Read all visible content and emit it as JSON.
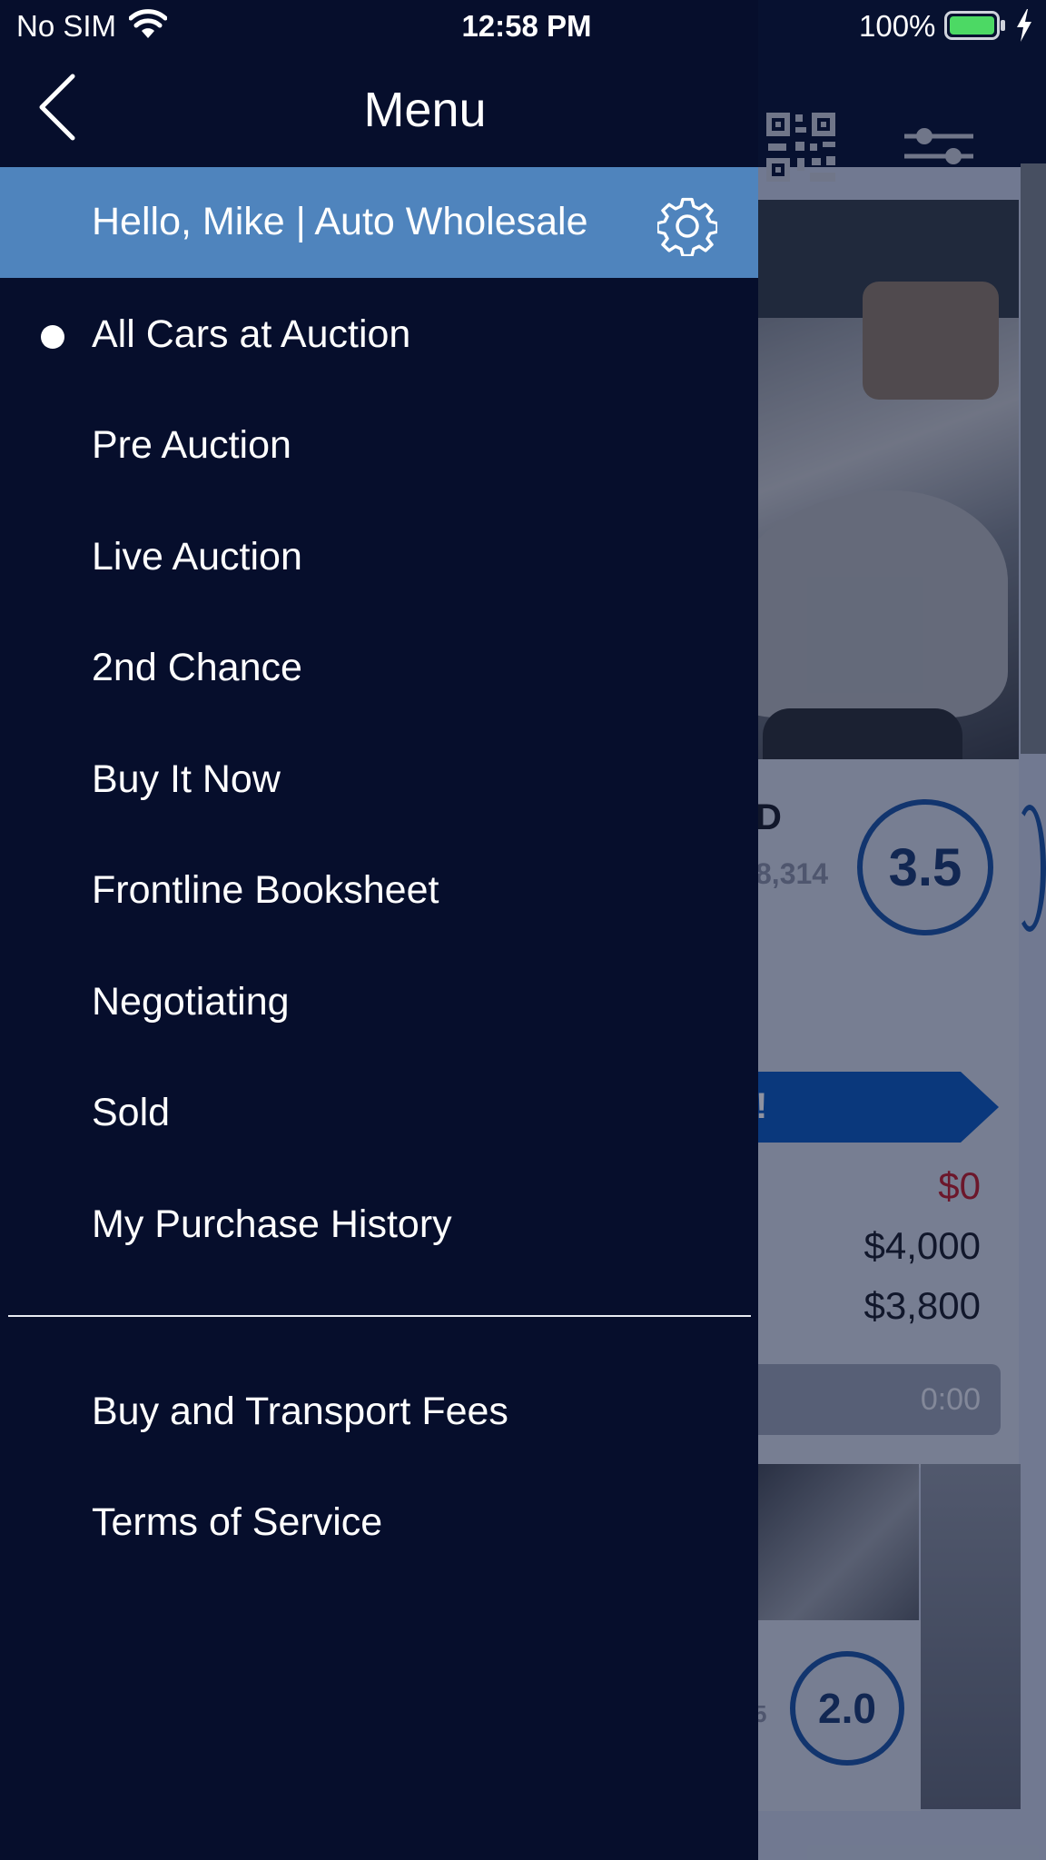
{
  "status_bar": {
    "carrier": "No SIM",
    "time": "12:58 PM",
    "battery": "100%",
    "icons": [
      "wifi-icon",
      "battery-icon",
      "charging-icon"
    ]
  },
  "drawer": {
    "title": "Menu",
    "back_icon": "chevron-left-icon",
    "user_greeting": "Hello, Mike | Auto Wholesale",
    "settings_icon": "gear-icon",
    "items": [
      {
        "label": "All Cars at Auction",
        "selected": true
      },
      {
        "label": "Pre Auction"
      },
      {
        "label": "Live Auction"
      },
      {
        "label": "2nd Chance"
      },
      {
        "label": "Buy It Now"
      },
      {
        "label": "Frontline Booksheet"
      },
      {
        "label": "Negotiating"
      },
      {
        "label": "Sold"
      },
      {
        "label": "My Purchase History"
      }
    ],
    "footer_items": [
      {
        "label": "Buy and Transport Fees"
      },
      {
        "label": "Terms of Service"
      }
    ]
  },
  "background": {
    "title_fragment": "D",
    "odometer_fragment": "8,314",
    "grade": "3.5",
    "bid_fragment": "!",
    "current_bid": "$0",
    "buy_price": "$4,000",
    "other_price": "$3,800",
    "timer": "0:00",
    "grade_2": "2.0",
    "fragment_2": "5",
    "icons": [
      "qr-code-icon",
      "filter-sliders-icon"
    ]
  },
  "colors": {
    "drawer_bg": "#060e2c",
    "user_row_bg": "#4f84bd",
    "accent_blue": "#0d5bbd",
    "price_red": "#c0202a"
  }
}
